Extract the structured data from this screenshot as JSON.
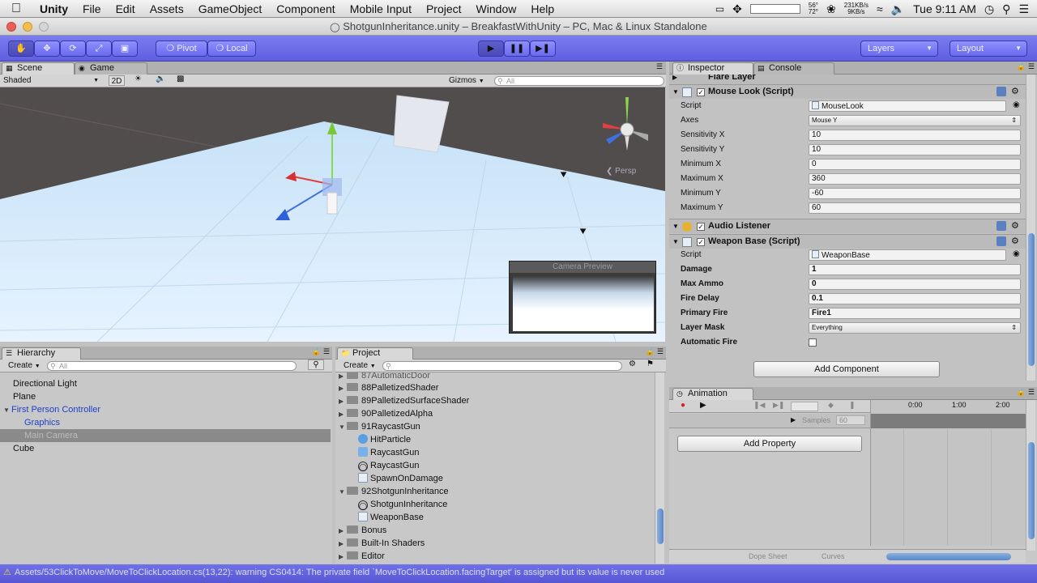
{
  "menubar": {
    "app": "Unity",
    "items": [
      "File",
      "Edit",
      "Assets",
      "GameObject",
      "Component",
      "Mobile Input",
      "Project",
      "Window",
      "Help"
    ],
    "temp": "56°",
    "temp2": "72°",
    "net_up": "231KB/s",
    "net_down": "9KB/s",
    "clock": "Tue 9:11 AM"
  },
  "window": {
    "title": "ShotgunInheritance.unity – BreakfastWithUnity – PC, Mac & Linux Standalone"
  },
  "toolbar": {
    "pivot": "Pivot",
    "local": "Local",
    "layers": "Layers",
    "layout": "Layout"
  },
  "scene": {
    "tab_scene": "Scene",
    "tab_game": "Game",
    "shading": "Shaded",
    "mode_2d": "2D",
    "gizmos": "Gizmos",
    "search_placeholder": "All",
    "persp": "Persp",
    "camera_preview": "Camera Preview"
  },
  "hierarchy": {
    "tab": "Hierarchy",
    "create": "Create",
    "search_placeholder": "All",
    "items": [
      "Directional Light",
      "Plane",
      "First Person Controller",
      "Graphics",
      "Main Camera",
      "Cube"
    ]
  },
  "project": {
    "tab": "Project",
    "create": "Create",
    "items": [
      "87AutomaticDoor",
      "88PalletizedShader",
      "89PalletizedSurfaceShader",
      "90PalletizedAlpha",
      "91RaycastGun",
      "HitParticle",
      "RaycastGun",
      "RaycastGun",
      "SpawnOnDamage",
      "92ShotgunInheritance",
      "ShotgunInheritance",
      "WeaponBase",
      "Bonus",
      "Built-In Shaders",
      "Editor"
    ]
  },
  "inspector": {
    "tab": "Inspector",
    "tab_console": "Console",
    "flare_layer": "Flare Layer",
    "mouse_look": {
      "title": "Mouse Look (Script)",
      "props": [
        {
          "label": "Script",
          "value": "MouseLook"
        },
        {
          "label": "Axes",
          "value": "Mouse Y"
        },
        {
          "label": "Sensitivity X",
          "value": "10"
        },
        {
          "label": "Sensitivity Y",
          "value": "10"
        },
        {
          "label": "Minimum X",
          "value": "0"
        },
        {
          "label": "Maximum X",
          "value": "360"
        },
        {
          "label": "Minimum Y",
          "value": "-60"
        },
        {
          "label": "Maximum Y",
          "value": "60"
        }
      ]
    },
    "audio_listener": "Audio Listener",
    "weapon_base": {
      "title": "Weapon Base (Script)",
      "props": [
        {
          "label": "Script",
          "value": "WeaponBase"
        },
        {
          "label": "Damage",
          "value": "1"
        },
        {
          "label": "Max Ammo",
          "value": "0"
        },
        {
          "label": "Fire Delay",
          "value": "0.1"
        },
        {
          "label": "Primary Fire",
          "value": "Fire1"
        },
        {
          "label": "Layer Mask",
          "value": "Everything"
        }
      ],
      "automatic_fire": "Automatic Fire"
    },
    "add_component": "Add Component"
  },
  "animation": {
    "tab": "Animation",
    "samples_label": "Samples",
    "samples_value": "60",
    "add_property": "Add Property",
    "t0": "0:00",
    "t1": "1:00",
    "t2": "2:00",
    "dope_sheet": "Dope Sheet",
    "curves": "Curves"
  },
  "status": {
    "message": "Assets/53ClickToMove/MoveToClickLocation.cs(13,22): warning CS0414: The private field `MoveToClickLocation.facingTarget' is assigned but its value is never used"
  },
  "colors": {
    "toolbar": "#6a6aee",
    "selection": "#8a8a8a",
    "link_blue": "#1e3ec8",
    "ground": "#cfe8ff"
  }
}
